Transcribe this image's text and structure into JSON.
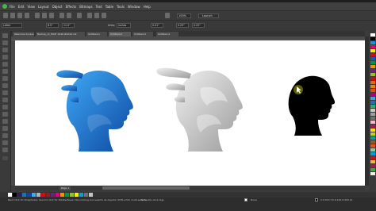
{
  "app": {
    "name": "CorelDRAW"
  },
  "menu": [
    "File",
    "Edit",
    "View",
    "Layout",
    "Object",
    "Effects",
    "Bitmaps",
    "Text",
    "Table",
    "Tools",
    "Window",
    "Help"
  ],
  "toolbar": {
    "zoom": "100%",
    "launch_label": "Launch"
  },
  "propbar": {
    "preset": "Letter",
    "width": "8.5\"",
    "height": "11.0\"",
    "units_label": "Units:",
    "units": "inches",
    "nudge": "0.01\"",
    "dup_x": "0.25\"",
    "dup_y": "0.25\""
  },
  "tabs": [
    {
      "label": "Welcome Screen"
    },
    {
      "label": "Backup_of_FACE 1616 #2222.cdr"
    },
    {
      "label": "Untitled-1"
    },
    {
      "label": "Untitled-2"
    },
    {
      "label": "Untitled-3"
    },
    {
      "label": "Untitled-4"
    }
  ],
  "active_tab": 4,
  "page": {
    "label": "Page 1"
  },
  "status": {
    "hint": "Next click for Drag/Scale; Second click for Rotate/Skew; Dbl-clicking tool selects all objects; Shift+click multi-selects; Alt+click digs",
    "info": "None",
    "coords": "C:0 M:0 Y:0 K:100  0.500 pt"
  },
  "colors": {
    "blue_light": "#3fa9f5",
    "blue_dark": "#0d47a1",
    "gray_light": "#f0f0f0",
    "gray_dark": "#9a9a9a",
    "silhouette": "#000000",
    "cursor": "#b8b800"
  }
}
